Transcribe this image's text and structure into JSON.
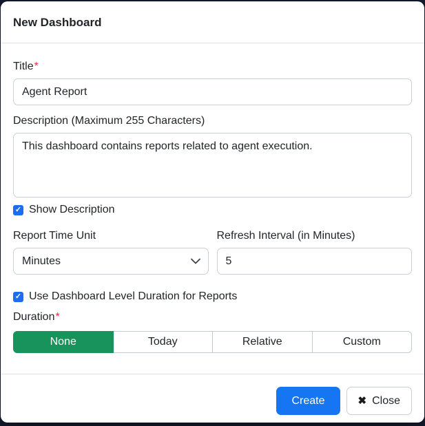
{
  "modal": {
    "title": "New Dashboard",
    "required_mark": "*",
    "fields": {
      "title": {
        "label": "Title",
        "value": "Agent Report"
      },
      "description": {
        "label": "Description (Maximum 255 Characters)",
        "value": "This dashboard contains reports related to agent execution."
      },
      "show_description": {
        "label": "Show Description",
        "checked": true,
        "check_glyph": "✓"
      },
      "report_time_unit": {
        "label": "Report Time Unit",
        "value": "Minutes"
      },
      "refresh_interval": {
        "label": "Refresh Interval (in Minutes)",
        "value": "5"
      },
      "use_dashboard_duration": {
        "label": "Use Dashboard Level Duration for Reports",
        "checked": true,
        "check_glyph": "✓"
      },
      "duration": {
        "label": "Duration",
        "options": [
          "None",
          "Today",
          "Relative",
          "Custom"
        ],
        "selected": "None"
      }
    },
    "footer": {
      "create_label": "Create",
      "close_label": "Close",
      "close_icon": "✖"
    },
    "colors": {
      "selected_green": "#17935b",
      "primary_blue": "#1675f2",
      "checkbox_blue": "#1b6ef3",
      "required_red": "#dc3545",
      "backdrop": "#141b2d"
    }
  }
}
